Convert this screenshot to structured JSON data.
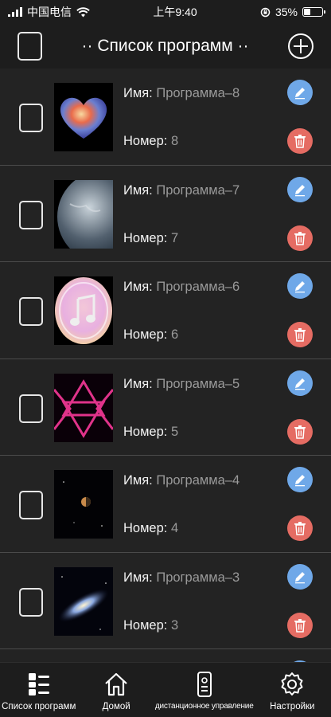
{
  "status_bar": {
    "carrier": "中国电信",
    "time": "上午9:40",
    "battery_text": "35%",
    "battery_level": 0.35
  },
  "header": {
    "title": "·· Список программ ··"
  },
  "programs": [
    {
      "name_label": "Имя:",
      "name": "Программа–8",
      "number_label": "Номер:",
      "number": "8",
      "thumb": "heart-nebula"
    },
    {
      "name_label": "Имя:",
      "name": "Программа–7",
      "number_label": "Номер:",
      "number": "7",
      "thumb": "earth"
    },
    {
      "name_label": "Имя:",
      "name": "Программа–6",
      "number_label": "Номер:",
      "number": "6",
      "thumb": "music-note"
    },
    {
      "name_label": "Имя:",
      "name": "Программа–5",
      "number_label": "Номер:",
      "number": "5",
      "thumb": "neon-triangles"
    },
    {
      "name_label": "Имя:",
      "name": "Программа–4",
      "number_label": "Номер:",
      "number": "4",
      "thumb": "planet-space"
    },
    {
      "name_label": "Имя:",
      "name": "Программа–3",
      "number_label": "Номер:",
      "number": "3",
      "thumb": "galaxy"
    }
  ],
  "tabbar": {
    "tabs": [
      {
        "label": "Список программ",
        "icon": "list-icon"
      },
      {
        "label": "Домой",
        "icon": "home-icon"
      },
      {
        "label": "дистанционное управление",
        "icon": "remote-icon"
      },
      {
        "label": "Настройки",
        "icon": "gear-icon"
      }
    ]
  },
  "colors": {
    "edit": "#6fa8e8",
    "delete": "#e56c63",
    "background": "#232323"
  }
}
